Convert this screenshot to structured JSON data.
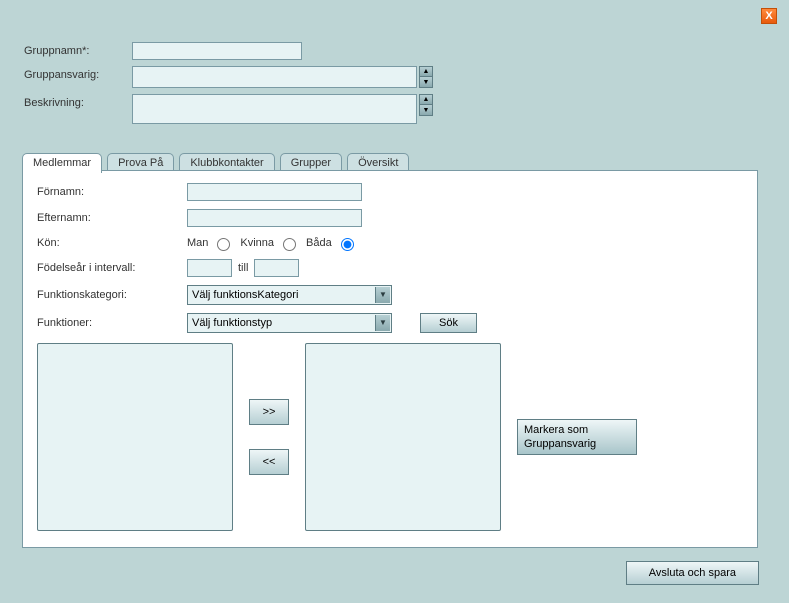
{
  "close_label": "X",
  "header": {
    "gruppnamn_label": "Gruppnamn*:",
    "gruppnamn_value": "",
    "gruppansvarig_label": "Gruppansvarig:",
    "gruppansvarig_value": "",
    "beskrivning_label": "Beskrivning:",
    "beskrivning_value": ""
  },
  "tabs": {
    "medlemmar": "Medlemmar",
    "prova": "Prova På",
    "klubb": "Klubbkontakter",
    "grupper": "Grupper",
    "oversikt": "Översikt"
  },
  "panel": {
    "fornamn_label": "Förnamn:",
    "fornamn_value": "",
    "efternamn_label": "Efternamn:",
    "efternamn_value": "",
    "kon_label": "Kön:",
    "kon_man": "Man",
    "kon_kvinna": "Kvinna",
    "kon_bada": "Båda",
    "fodelse_label": "Födelseår i intervall:",
    "fodelse_from": "",
    "fodelse_till_label": "till",
    "fodelse_to": "",
    "funkkat_label": "Funktionskategori:",
    "funkkat_value": "Välj funktionsKategori",
    "funk_label": "Funktioner:",
    "funk_value": "Välj funktionstyp",
    "sok_label": "Sök",
    "move_right": ">>",
    "move_left": "<<",
    "mark_line1": "Markera som",
    "mark_line2": "Gruppansvarig"
  },
  "footer": {
    "save_label": "Avsluta och spara"
  }
}
